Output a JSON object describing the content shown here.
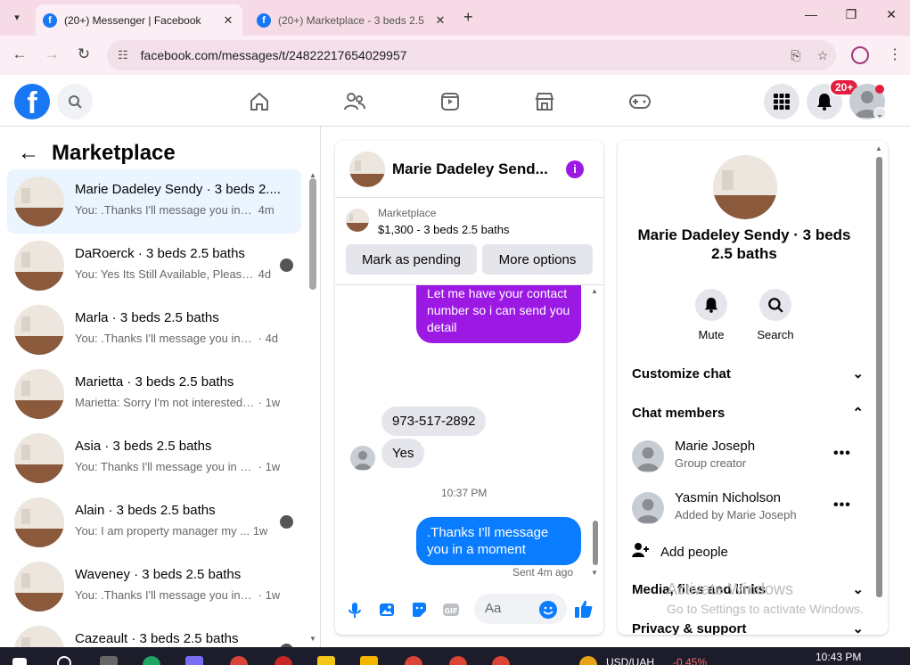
{
  "browser": {
    "tabs": [
      {
        "title": "(20+) Messenger | Facebook",
        "active": true
      },
      {
        "title": "(20+) Marketplace - 3 beds 2.5",
        "active": false
      }
    ],
    "url": "facebook.com/messages/t/24822217654029957"
  },
  "fb": {
    "logo": "f",
    "notif_badge": "20+",
    "nav_icons": [
      "home-icon",
      "friends-icon",
      "watch-icon",
      "marketplace-icon",
      "gaming-icon"
    ]
  },
  "left": {
    "title": "Marketplace",
    "conversations": [
      {
        "name": "Marie Dadeley Sendy · 3 beds 2....",
        "snippet": "You: .Thanks I'll message you in a ...",
        "time": "4m",
        "selected": true
      },
      {
        "name": "DaRoerck · 3 beds 2.5 baths",
        "snippet": "You: Yes Its Still Available, Please ...",
        "time": "4d"
      },
      {
        "name": "Marla · 3 beds 2.5 baths",
        "snippet": "You: .Thanks I'll message you in a ...",
        "time": "· 4d"
      },
      {
        "name": "Marietta · 3 beds 2.5 baths",
        "snippet": "Marietta: Sorry I'm not interested a...",
        "time": "· 1w"
      },
      {
        "name": "Asia · 3 beds 2.5 baths",
        "snippet": "You: Thanks I'll message you in a ...",
        "time": "· 1w"
      },
      {
        "name": "Alain · 3 beds 2.5 baths",
        "snippet": "You: I am property manager my ...",
        "time": "1w"
      },
      {
        "name": "Waveney · 3 beds 2.5 baths",
        "snippet": "You: .Thanks I'll message you in a ...",
        "time": "· 1w"
      },
      {
        "name": "Cazeault · 3 beds 2.5 baths",
        "snippet": "",
        "time": ""
      }
    ]
  },
  "chat": {
    "header_name": "Marie Dadeley Send...",
    "listing_category": "Marketplace",
    "listing_price": "$1,300 - 3 beds 2.5 baths",
    "mark_pending": "Mark as pending",
    "more_options": "More options",
    "msg_out_1": "Let me have your contact number so i can send you detail",
    "msg_in_1": "973-517-2892",
    "msg_in_2": "Yes",
    "timestamp": "10:37 PM",
    "msg_out_2": ".Thanks I'll message you in a moment",
    "sent_status": "Sent 4m ago",
    "composer_placeholder": "Aa"
  },
  "details": {
    "name": "Marie Dadeley Sendy · 3 beds 2.5 baths",
    "mute": "Mute",
    "search": "Search",
    "customize_chat": "Customize chat",
    "chat_members": "Chat members",
    "members": [
      {
        "name": "Marie Joseph",
        "role": "Group creator"
      },
      {
        "name": "Yasmin Nicholson",
        "role": "Added by Marie Joseph"
      }
    ],
    "add_people": "Add people",
    "media_files_links": "Media, files and links",
    "privacy_support": "Privacy & support"
  },
  "watermark": {
    "line1": "Activate Windows",
    "line2": "Go to Settings to activate Windows."
  },
  "taskbar": {
    "currency": "USD/UAH",
    "change": "-0.45%",
    "time": "10:43 PM"
  },
  "colors": {
    "fb_blue": "#1877f2",
    "purple_bubble": "#9c19e4",
    "blue_bubble": "#0a7cff",
    "selected_conv": "#ebf5ff"
  }
}
